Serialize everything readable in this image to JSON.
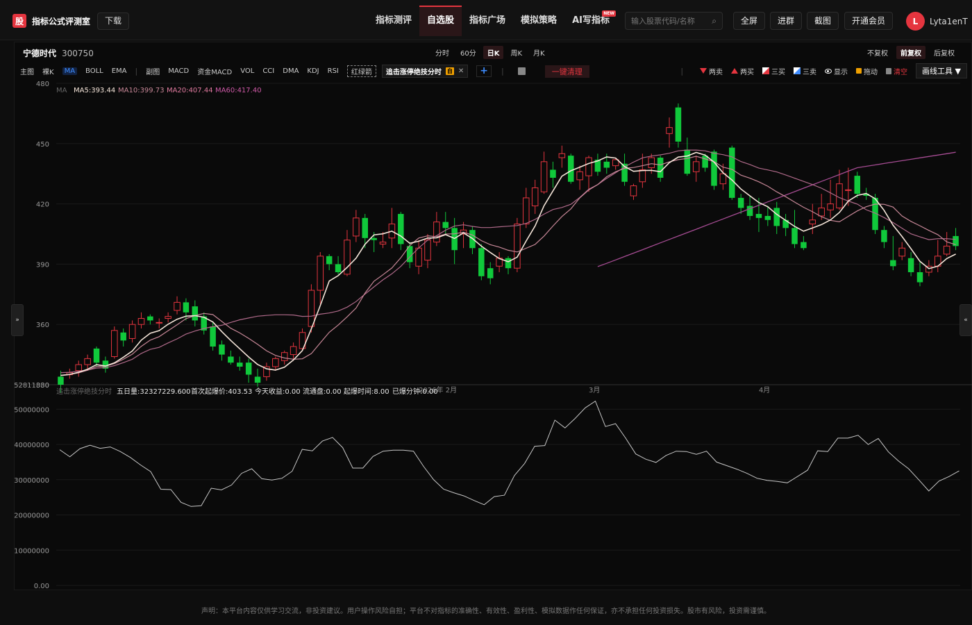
{
  "brand": {
    "logo_char": "股",
    "name": "指标公式评测室",
    "download_label": "下载"
  },
  "nav": [
    {
      "label": "指标测评",
      "active": false
    },
    {
      "label": "自选股",
      "active": true
    },
    {
      "label": "指标广场",
      "active": false
    },
    {
      "label": "模拟策略",
      "active": false
    },
    {
      "label": "AI写指标",
      "active": false,
      "badge": "NEW"
    }
  ],
  "search": {
    "placeholder": "输入股票代码/名称"
  },
  "tools": {
    "fullscreen": "全屏",
    "join_group": "进群",
    "screenshot": "截图",
    "membership": "开通会员"
  },
  "user": {
    "initial": "L",
    "name": "Lyta1enT"
  },
  "stock": {
    "name": "宁德时代",
    "code": "300750"
  },
  "periods": [
    {
      "label": "分时",
      "active": false
    },
    {
      "label": "60分",
      "active": false
    },
    {
      "label": "日K",
      "active": true
    },
    {
      "label": "周K",
      "active": false
    },
    {
      "label": "月K",
      "active": false
    }
  ],
  "adjust": [
    {
      "label": "不复权",
      "active": false
    },
    {
      "label": "前复权",
      "active": true
    },
    {
      "label": "后复权",
      "active": false
    }
  ],
  "indicators": {
    "main_label": "主图",
    "bare_k": "裸K",
    "main": [
      {
        "label": "MA",
        "active": true
      },
      {
        "label": "BOLL"
      },
      {
        "label": "EMA"
      }
    ],
    "sub_label": "副图",
    "sub": [
      "MACD",
      "资金MACD",
      "VOL",
      "CCI",
      "DMA",
      "KDJ",
      "RSI"
    ],
    "boxed": "红绿箭",
    "chip_label": "追击涨停绝技分时",
    "chip_tag": "自",
    "clear_label": "一键清理"
  },
  "draw_tools": {
    "two_sell": "两卖",
    "two_buy": "两买",
    "three_buy": "三买",
    "three_sell": "三卖",
    "show": "显示",
    "drag": "拖动",
    "clear": "清空",
    "menu": "画线工具 ▼"
  },
  "ma_legend": {
    "title": "MA",
    "ma5": "MA5:393.44",
    "ma10": "MA10:399.73",
    "ma20": "MA20:407.44",
    "ma60": "MA60:417.40"
  },
  "sub_legend": {
    "title": "追击涨停绝技分时",
    "items": [
      "五日量:32327229.600",
      "首次起爆价:403.53",
      "今天收益:0.00",
      "流通盘:0.00",
      "起爆时间:8.00",
      "已爆分钟:0.00"
    ]
  },
  "x_labels": [
    {
      "text": "2026年",
      "i": 40
    },
    {
      "text": "2月",
      "i": 43
    },
    {
      "text": "3月",
      "i": 59
    },
    {
      "text": "4月",
      "i": 78
    }
  ],
  "main_axis": {
    "ticks": [
      "480",
      "450",
      "420",
      "390",
      "360",
      "330"
    ],
    "min": 330,
    "max": 480,
    "top_readout": "52811880"
  },
  "sub_axis": {
    "ticks": [
      "50000000",
      "40000000",
      "30000000",
      "20000000",
      "10000000",
      "0.00"
    ],
    "max": 54000000
  },
  "colors": {
    "up": "#e5353f",
    "down": "#10c93b",
    "ma5": "#f6e6da",
    "ma10": "#c88898",
    "ma20": "#b06a8a",
    "ma60": "#a64c93",
    "sub_line": "#c8c8c8"
  },
  "footer": "声明：本平台内容仅供学习交流，非投资建议。用户操作风险自担；平台不对指标的准确性、有效性、盈利性、模拟数据作任何保证，亦不承担任何投资损失。股市有风险，投资需谨慎。",
  "chart_data": {
    "type": "candlestick",
    "candles": [
      [
        334,
        330,
        337,
        326
      ],
      [
        335,
        336,
        338,
        333
      ],
      [
        337,
        340,
        342,
        334
      ],
      [
        340,
        343,
        345,
        337
      ],
      [
        348,
        341,
        349,
        339
      ],
      [
        342,
        338,
        344,
        336
      ],
      [
        344,
        357,
        359,
        343
      ],
      [
        356,
        352,
        358,
        349
      ],
      [
        353,
        360,
        362,
        351
      ],
      [
        360,
        363,
        366,
        358
      ],
      [
        364,
        362,
        365,
        360
      ],
      [
        361,
        361,
        363,
        358
      ],
      [
        363,
        364,
        366,
        361
      ],
      [
        367,
        371,
        374,
        365
      ],
      [
        371,
        366,
        373,
        362
      ],
      [
        369,
        362,
        372,
        359
      ],
      [
        364,
        357,
        366,
        355
      ],
      [
        359,
        349,
        361,
        347
      ],
      [
        350,
        345,
        352,
        342
      ],
      [
        344,
        341,
        347,
        340
      ],
      [
        341,
        339,
        344,
        337
      ],
      [
        341,
        335,
        343,
        331
      ],
      [
        334,
        331,
        338,
        329
      ],
      [
        334,
        339,
        341,
        332
      ],
      [
        339,
        343,
        344,
        337
      ],
      [
        342,
        346,
        347,
        340
      ],
      [
        345,
        349,
        351,
        342
      ],
      [
        348,
        356,
        358,
        347
      ],
      [
        359,
        377,
        380,
        356
      ],
      [
        377,
        394,
        396,
        370
      ],
      [
        394,
        390,
        395,
        387
      ],
      [
        390,
        386,
        394,
        385
      ],
      [
        385,
        402,
        407,
        384
      ],
      [
        404,
        413,
        417,
        401
      ],
      [
        413,
        403,
        415,
        398
      ],
      [
        403,
        402,
        406,
        396
      ],
      [
        400,
        401,
        406,
        398
      ],
      [
        403,
        410,
        418,
        398
      ],
      [
        415,
        400,
        416,
        397
      ],
      [
        399,
        391,
        401,
        388
      ],
      [
        389,
        398,
        402,
        385
      ],
      [
        392,
        402,
        405,
        388
      ],
      [
        401,
        411,
        416,
        399
      ],
      [
        411,
        408,
        416,
        405
      ],
      [
        408,
        397,
        413,
        390
      ],
      [
        405,
        407,
        411,
        398
      ],
      [
        407,
        398,
        409,
        395
      ],
      [
        398,
        384,
        400,
        382
      ],
      [
        388,
        383,
        391,
        380
      ],
      [
        389,
        393,
        396,
        386
      ],
      [
        393,
        388,
        394,
        385
      ],
      [
        388,
        410,
        413,
        386
      ],
      [
        410,
        423,
        428,
        408
      ],
      [
        419,
        428,
        432,
        415
      ],
      [
        426,
        441,
        446,
        425
      ],
      [
        437,
        433,
        441,
        428
      ],
      [
        443,
        445,
        449,
        438
      ],
      [
        444,
        431,
        445,
        430
      ],
      [
        432,
        436,
        439,
        427
      ],
      [
        434,
        443,
        444,
        426
      ],
      [
        442,
        436,
        445,
        434
      ],
      [
        441,
        438,
        445,
        435
      ],
      [
        439,
        442,
        443,
        437
      ],
      [
        440,
        431,
        445,
        429
      ],
      [
        424,
        429,
        430,
        422
      ],
      [
        431,
        437,
        445,
        428
      ],
      [
        438,
        443,
        445,
        435
      ],
      [
        443,
        433,
        444,
        431
      ],
      [
        455,
        458,
        463,
        448
      ],
      [
        468,
        451,
        470,
        448
      ],
      [
        447,
        435,
        453,
        434
      ],
      [
        436,
        441,
        444,
        431
      ],
      [
        444,
        438,
        445,
        436
      ],
      [
        446,
        429,
        447,
        427
      ],
      [
        430,
        435,
        440,
        427
      ],
      [
        448,
        423,
        449,
        422
      ],
      [
        423,
        418,
        425,
        415
      ],
      [
        419,
        414,
        424,
        412
      ],
      [
        415,
        413,
        423,
        406
      ],
      [
        414,
        412,
        419,
        409
      ],
      [
        418,
        409,
        421,
        405
      ],
      [
        412,
        408,
        415,
        404
      ],
      [
        408,
        400,
        417,
        398
      ],
      [
        401,
        398,
        404,
        397
      ],
      [
        410,
        412,
        420,
        405
      ],
      [
        414,
        418,
        425,
        412
      ],
      [
        417,
        420,
        432,
        413
      ],
      [
        418,
        430,
        437,
        417
      ],
      [
        427,
        427,
        438,
        419
      ],
      [
        434,
        425,
        436,
        423
      ],
      [
        425,
        424,
        428,
        422
      ],
      [
        423,
        407,
        425,
        405
      ],
      [
        407,
        401,
        409,
        398
      ],
      [
        392,
        389,
        404,
        387
      ],
      [
        394,
        398,
        401,
        392
      ],
      [
        393,
        386,
        396,
        384
      ],
      [
        386,
        381,
        391,
        379
      ],
      [
        386,
        389,
        392,
        384
      ],
      [
        389,
        394,
        402,
        386
      ],
      [
        395,
        399,
        406,
        394
      ],
      [
        404,
        399,
        408,
        397
      ]
    ],
    "ma5": [
      334.6,
      335.1,
      336.2,
      337.7,
      340,
      339.3,
      340.9,
      343.7,
      346.8,
      352.2,
      355.6,
      356.9,
      360.1,
      362.6,
      364.1,
      364.4,
      363.6,
      361.2,
      356.4,
      352,
      347.9,
      343.8,
      340.1,
      337.9,
      337.3,
      338.7,
      342.3,
      347,
      357.8,
      369.4,
      381.6,
      384.3,
      388.4,
      393,
      399.9,
      404.6,
      405.1,
      406.4,
      404,
      400.4,
      401.4,
      403,
      403.1,
      404.7,
      402.8,
      405.6,
      402.8,
      399,
      395.8,
      392.8,
      391.2,
      393.5,
      401.5,
      409,
      419.1,
      426.5,
      433.8,
      436.5,
      438.3,
      440.1,
      441.4,
      443.4,
      442.8,
      438.6,
      436.2,
      436.6,
      436.7,
      436,
      440.5,
      443.3,
      443.8,
      445.6,
      444.3,
      440.8,
      435.5,
      431.9,
      427.4,
      424,
      420.7,
      418.6,
      414.8,
      411.8,
      408.8,
      406.4,
      408,
      409.7,
      412,
      415.7,
      421.4,
      424.2,
      425.2,
      422.6,
      416.8,
      409.4,
      403.8,
      397.7,
      391.4,
      387.8,
      389,
      392.8,
      395
    ],
    "ma10": [
      334.7,
      335.1,
      335.9,
      337.2,
      339.1,
      339.2,
      340.5,
      342.7,
      345.2,
      349.1,
      352.2,
      353.9,
      356.9,
      359.8,
      362.9,
      364.4,
      365.5,
      364.9,
      361.5,
      358.1,
      355.8,
      353.1,
      350.1,
      346.9,
      344.6,
      343.3,
      342.7,
      342.9,
      345.5,
      350.8,
      356.1,
      359.7,
      363.8,
      368.2,
      375.6,
      381.5,
      384.7,
      388.1,
      393.2,
      399.3,
      403,
      404.1,
      403.7,
      405,
      405.1,
      405.9,
      404.5,
      401.7,
      399.7,
      398.5,
      396.9,
      396.1,
      397.9,
      399.8,
      404,
      409,
      413.7,
      417.5,
      423,
      426.9,
      429.6,
      433.5,
      436,
      437.7,
      438.1,
      439,
      440,
      439.4,
      440.9,
      442,
      442.6,
      443.7,
      442.4,
      441,
      438.3,
      437.2,
      434.3,
      432.8,
      431,
      428.8,
      426,
      423.6,
      420.9,
      418.3,
      416.1,
      413.6,
      411.8,
      411.1,
      413.8,
      416.5,
      418.6,
      419.9,
      419.8,
      418.4,
      414,
      411.3,
      409.1,
      406.8,
      404.7,
      401.1,
      399.7
    ],
    "ma20": [
      336,
      336.2,
      336.7,
      337.3,
      338.3,
      338.5,
      339.5,
      341,
      342.7,
      345.6,
      347.6,
      348.6,
      350.8,
      352.8,
      355.2,
      356.7,
      358,
      358.9,
      359.6,
      361,
      362.3,
      363.2,
      364.1,
      364.5,
      364.8,
      364.8,
      364.7,
      364,
      364.1,
      365.1,
      365.7,
      366.7,
      368.6,
      371.4,
      375.1,
      378.7,
      382.2,
      385.2,
      388.9,
      393.6,
      398.1,
      402,
      404.2,
      406.9,
      409,
      409.6,
      408.8,
      408.2,
      408.2,
      408.6,
      408.9,
      409.2,
      410.3,
      412.3,
      414.9,
      417.2,
      418.2,
      419.8,
      423.2,
      427.3,
      429.6,
      432.7,
      435.5,
      438.4,
      440.8,
      442.9,
      443.8,
      444.4,
      445.2,
      446.4,
      446.8,
      446.8,
      446.4,
      445.2,
      444.5,
      443.4,
      441.1,
      439.6,
      437.8,
      436.9,
      435.9,
      434.4,
      432.8,
      431.2,
      429.6,
      427.8,
      425.5,
      423.1,
      421.4,
      419.9,
      417.1,
      415.4,
      413.2,
      410.7,
      407.9,
      405.1,
      403.6,
      402.2,
      402.7,
      402.7,
      402.3
    ],
    "ma60": [
      null,
      null,
      null,
      null,
      null,
      null,
      null,
      null,
      null,
      null,
      null,
      null,
      null,
      null,
      null,
      null,
      null,
      null,
      null,
      null,
      null,
      null,
      null,
      null,
      null,
      null,
      null,
      null,
      null,
      null,
      null,
      null,
      null,
      null,
      null,
      null,
      null,
      null,
      null,
      null,
      null,
      null,
      null,
      null,
      null,
      null,
      null,
      null,
      null,
      null,
      null,
      null,
      null,
      null,
      null,
      null,
      null,
      null,
      null,
      null,
      388.8,
      390.4,
      392.1,
      393.8,
      395.5,
      397.2,
      398.9,
      400.6,
      402.3,
      404,
      405.7,
      407.4,
      409.1,
      410.8,
      412.5,
      414.2,
      415.9,
      417.6,
      419.3,
      421,
      422.7,
      424.4,
      426.1,
      427.8,
      429.5,
      431.2,
      432.9,
      434.6,
      436.3,
      438,
      438.7,
      439.4,
      440.1,
      440.8,
      441.5,
      442.2,
      442.9,
      443.6,
      444.3,
      445,
      445.7
    ],
    "sub_series": [
      38500000,
      36500000,
      38800000,
      39800000,
      38900000,
      39300000,
      38000000,
      36300000,
      34200000,
      32300000,
      27300000,
      27200000,
      23600000,
      22400000,
      22600000,
      27600000,
      27100000,
      28500000,
      31800000,
      33100000,
      30300000,
      29900000,
      30400000,
      32400000,
      38600000,
      38200000,
      41000000,
      42000000,
      39100000,
      33300000,
      33300000,
      36600000,
      38100000,
      38400000,
      38400000,
      38100000,
      33800000,
      30000000,
      27300000,
      26300000,
      25400000,
      24100000,
      22900000,
      25200000,
      25600000,
      31200000,
      34600000,
      39500000,
      39700000,
      46900000,
      44700000,
      47400000,
      50400000,
      52300000,
      45100000,
      45900000,
      41800000,
      37300000,
      35800000,
      34900000,
      36900000,
      38100000,
      38000000,
      37200000,
      38100000,
      35000000,
      34000000,
      33000000,
      31800000,
      30400000,
      29800000,
      29500000,
      29100000,
      30900000,
      32700000,
      38200000,
      38000000,
      41800000,
      41800000,
      42600000,
      40000000,
      41700000,
      37900000,
      35300000,
      33100000,
      30000000,
      26800000,
      29600000,
      30900000,
      32500000
    ]
  }
}
